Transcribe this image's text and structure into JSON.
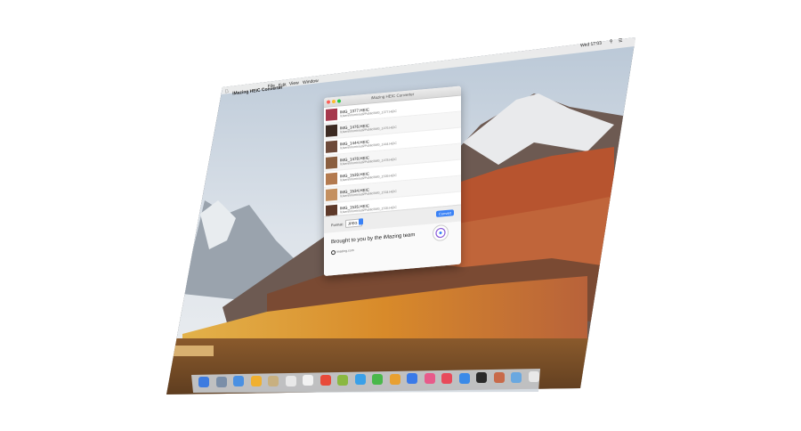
{
  "menubar": {
    "app_name": "iMazing HEIC Converter",
    "items": [
      "File",
      "Edit",
      "View",
      "Window"
    ],
    "clock": "Wed 17:03"
  },
  "window": {
    "title": "iMazing HEIC Converter",
    "files": [
      {
        "name": "IMG_1377.HEIC",
        "path": "/Users/morrisrudi/Public/IMG_1377.HEIC",
        "color": "#a6394d"
      },
      {
        "name": "IMG_1476.HEIC",
        "path": "/Users/morrisrudi/Public/IMG_1476.HEIC",
        "color": "#3c2a22"
      },
      {
        "name": "IMG_1444.HEIC",
        "path": "/Users/morrisrudi/Public/IMG_1444.HEIC",
        "color": "#6d4a3a"
      },
      {
        "name": "IMG_1478.HEIC",
        "path": "/Users/morrisrudi/Public/IMG_1478.HEIC",
        "color": "#8a5e3f"
      },
      {
        "name": "IMG_1539.HEIC",
        "path": "/Users/morrisrudi/Public/IMG_1539.HEIC",
        "color": "#b37a4f"
      },
      {
        "name": "IMG_1534.HEIC",
        "path": "/Users/morrisrudi/Public/IMG_1534.HEIC",
        "color": "#c49060"
      },
      {
        "name": "IMG_1535.HEIC",
        "path": "/Users/morrisrudi/Public/IMG_1535.HEIC",
        "color": "#5e3a2a"
      }
    ],
    "format_label": "Format:",
    "format_value": "JPEG",
    "convert_label": "Convert",
    "promo_text": "Brought to you by the iMazing team",
    "promo_link": "imazing.com"
  },
  "colors": {
    "accent": "#3a82f6"
  }
}
